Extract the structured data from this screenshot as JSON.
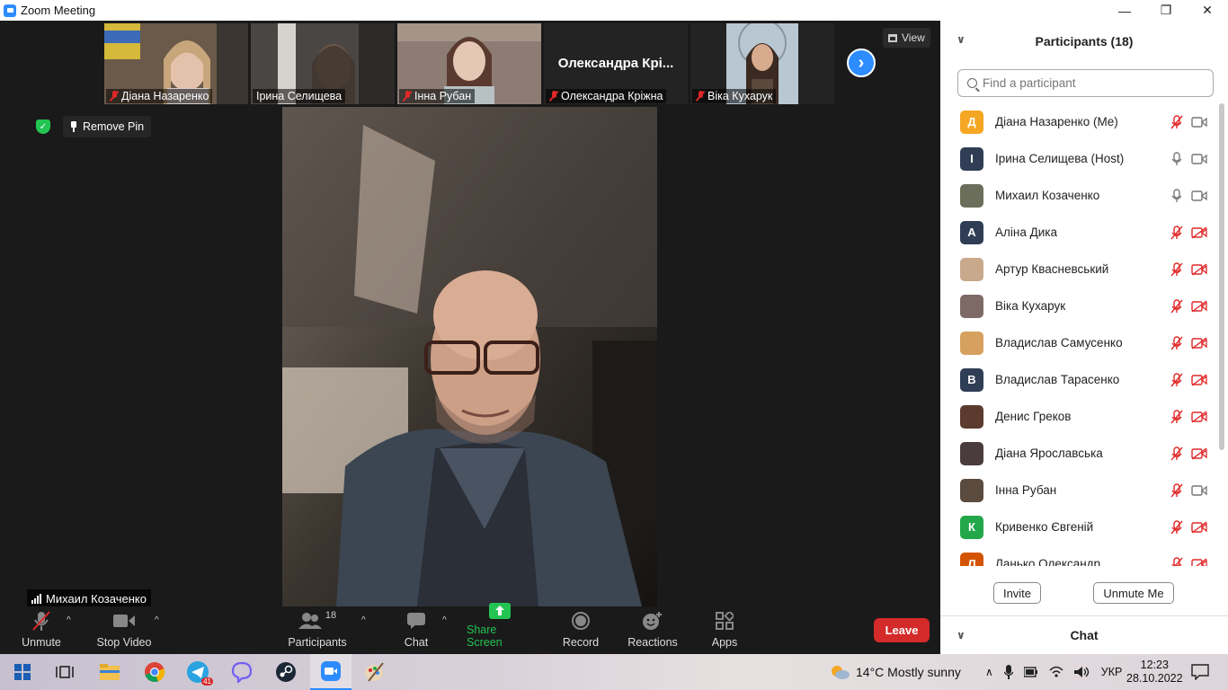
{
  "window": {
    "title": "Zoom Meeting",
    "controls": [
      "—",
      "❐",
      "✕"
    ]
  },
  "thumbnails": [
    {
      "name": "Діана Назаренко",
      "muted": true,
      "has_video": true
    },
    {
      "name": "Ірина Селищева",
      "muted": false,
      "has_video": true
    },
    {
      "name": "Інна Рубан",
      "muted": true,
      "has_video": true
    },
    {
      "name": "Олександра Кріжна",
      "display_name": "Олександра  Крі...",
      "muted": true,
      "has_video": false
    },
    {
      "name": "Віка Кухарук",
      "muted": true,
      "has_video": true
    }
  ],
  "view_button": "View",
  "next_page_icon": "chevron-right-icon",
  "remove_pin": "Remove Pin",
  "active_speaker": "Михаил Козаченко",
  "toolbar": {
    "unmute": "Unmute",
    "stop_video": "Stop Video",
    "participants": "Participants",
    "participants_count": "18",
    "chat": "Chat",
    "share_screen": "Share Screen",
    "record": "Record",
    "reactions": "Reactions",
    "apps": "Apps",
    "leave": "Leave"
  },
  "panel": {
    "title": "Participants (18)",
    "search_placeholder": "Find a participant",
    "invite": "Invite",
    "unmute_me": "Unmute Me",
    "chat_title": "Chat",
    "participants": [
      {
        "name": "Діана Назаренко (Me)",
        "initial": "Д",
        "color": "#f5a623",
        "mic": "muted",
        "cam": "on"
      },
      {
        "name": "Ірина Селищева (Host)",
        "initial": "І",
        "color": "#2f3d55",
        "mic": "on",
        "cam": "on"
      },
      {
        "name": "Михаил Козаченко",
        "initial": "",
        "color": "#6b6e5a",
        "mic": "on",
        "cam": "on"
      },
      {
        "name": "Аліна Дика",
        "initial": "А",
        "color": "#2f3d55",
        "mic": "muted",
        "cam": "off"
      },
      {
        "name": "Артур Квасневський",
        "initial": "",
        "color": "#c9a98c",
        "mic": "muted",
        "cam": "off"
      },
      {
        "name": "Віка Кухарук",
        "initial": "",
        "color": "#7d6a66",
        "mic": "muted",
        "cam": "off"
      },
      {
        "name": "Владислав Самусенко",
        "initial": "",
        "color": "#d6a15e",
        "mic": "muted",
        "cam": "off"
      },
      {
        "name": "Владислав Тарасенко",
        "initial": "В",
        "color": "#2f3d55",
        "mic": "muted",
        "cam": "off"
      },
      {
        "name": "Денис Греков",
        "initial": "",
        "color": "#5c3a2e",
        "mic": "muted",
        "cam": "off"
      },
      {
        "name": "Діана Ярославська",
        "initial": "",
        "color": "#4a3c3c",
        "mic": "muted",
        "cam": "off"
      },
      {
        "name": "Інна Рубан",
        "initial": "",
        "color": "#5b4b3f",
        "mic": "muted",
        "cam": "on"
      },
      {
        "name": "Кривенко Євгеній",
        "initial": "К",
        "color": "#23a74a",
        "mic": "muted",
        "cam": "off"
      },
      {
        "name": "Ланько Олександр",
        "initial": "Л",
        "color": "#d35400",
        "mic": "muted",
        "cam": "off"
      }
    ]
  },
  "taskbar": {
    "weather": "14°C  Mostly sunny",
    "language": "УКР",
    "time": "12:23",
    "date": "28.10.2022",
    "telegram_badge": "41"
  }
}
